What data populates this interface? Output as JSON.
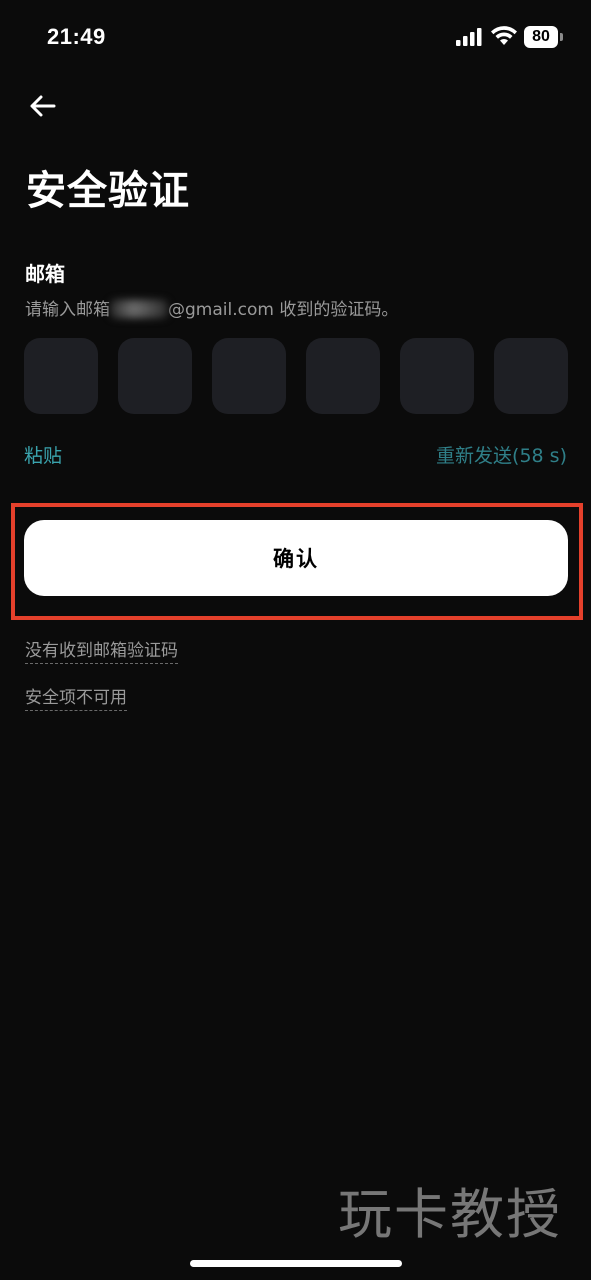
{
  "status_bar": {
    "time": "21:49",
    "battery": "80",
    "icons": [
      "signal-icon",
      "wifi-icon",
      "battery-icon"
    ]
  },
  "header": {
    "back_icon": "arrow-left-icon",
    "title": "安全验证"
  },
  "email_section": {
    "label": "邮箱",
    "instruction_prefix": "请输入邮箱",
    "instruction_suffix": "@gmail.com 收到的验证码。",
    "code_boxes": [
      "",
      "",
      "",
      "",
      "",
      ""
    ]
  },
  "actions": {
    "paste_label": "粘贴",
    "resend_label": "重新发送(58 s)",
    "confirm_label": "确认"
  },
  "help_links": {
    "no_email_code": "没有收到邮箱验证码",
    "security_unavailable": "安全项不可用"
  },
  "watermark": "玩卡教授",
  "colors": {
    "background": "#0b0b0b",
    "code_box": "#1e1f24",
    "accent_teal": "#3aa3ad",
    "highlight_red": "#e5402b"
  }
}
